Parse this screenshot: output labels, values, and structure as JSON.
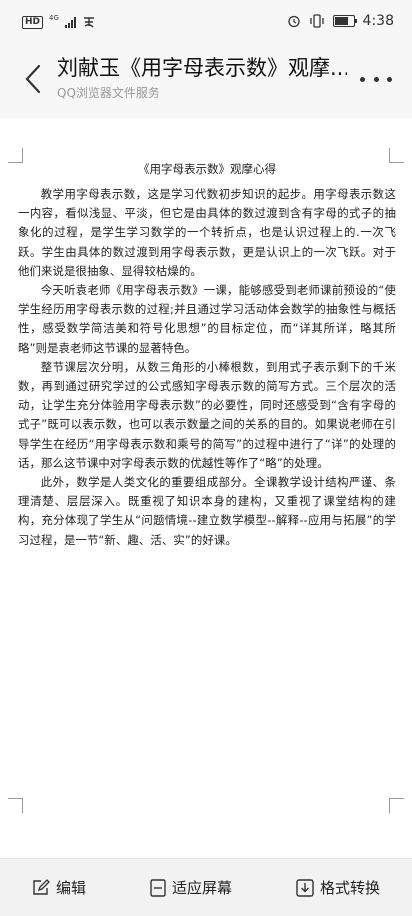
{
  "status_bar": {
    "hd": "HD",
    "network": "4G",
    "time": "4:38",
    "battery_level": 0.7
  },
  "header": {
    "title": "刘献玉《用字母表示数》观摩...",
    "subtitle": "QQ浏览器文件服务",
    "back_icon": "chevron-left-icon",
    "more_icon": "more-horizontal-icon"
  },
  "document": {
    "title": "《用字母表示数》观摩心得",
    "paragraphs": [
      "教学用字母表示数，这是学习代数初步知识的起步。用字母表示数这一内容，看似浅显、平淡，但它是由具体的数过渡到含有字母的式子的抽象化的过程，是学生学习数学的一个转折点，也是认识过程上的.一次飞跃。学生由具体的数过渡到用字母表示数，更是认识上的一次飞跃。对于他们来说是很抽象、显得较枯燥的。",
      "今天听袁老师《用字母表示数》一课，能够感受到老师课前预设的“使学生经历用字母表示数的过程;并且通过学习活动体会数学的抽象性与概括性，感受数学简洁美和符号化思想”的目标定位，而“详其所详，略其所略”则是袁老师这节课的显著特色。",
      "整节课层次分明，从数三角形的小棒根数，到用式子表示剩下的千米数，再到通过研究学过的公式感知字母表示数的简写方式。三个层次的活动，让学生充分体验用字母表示数”的必要性，同时还感受到“含有字母的式子”既可以表示数，也可以表示数量之间的关系的目的。如果说老师在引导学生在经历“用字母表示数和乘号的简写”的过程中进行了“详”的处理的话，那么这节课中对字母表示数的优越性等作了“略”的处理。",
      "此外，数学是人类文化的重要组成部分。全课教学设计结构严谨、条理清楚、层层深入。既重视了知识本身的建构，又重视了课堂结构的建构，充分体现了学生从“问题情境--建立数学模型--解释--应用与拓展”的学习过程，是一节“新、趣、活、实”的好课。"
    ]
  },
  "toolbar": {
    "edit_label": "编辑",
    "fit_label": "适应屏幕",
    "convert_label": "格式转换"
  }
}
